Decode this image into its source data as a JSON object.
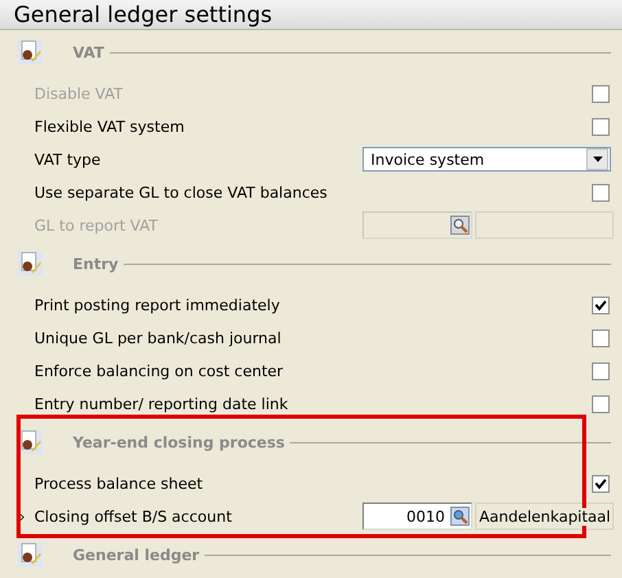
{
  "title": "General ledger settings",
  "sections": [
    {
      "heading": "VAT",
      "highlighted": false,
      "rows": [
        {
          "kind": "checkbox",
          "label": "Disable VAT",
          "disabled": true,
          "checked": false
        },
        {
          "kind": "checkbox",
          "label": "Flexible VAT system",
          "disabled": false,
          "checked": false
        },
        {
          "kind": "select",
          "label": "VAT type",
          "disabled": false,
          "value": "Invoice system"
        },
        {
          "kind": "checkbox",
          "label": "Use separate GL to close VAT balances",
          "disabled": false,
          "checked": false
        },
        {
          "kind": "lookup",
          "label": "GL to report VAT",
          "disabled": true
        }
      ]
    },
    {
      "heading": "Entry",
      "highlighted": false,
      "rows": [
        {
          "kind": "checkbox",
          "label": "Print posting report immediately",
          "disabled": false,
          "checked": true
        },
        {
          "kind": "checkbox",
          "label": "Unique GL per bank/cash journal",
          "disabled": false,
          "checked": false
        },
        {
          "kind": "checkbox",
          "label": "Enforce balancing on cost center",
          "disabled": false,
          "checked": false
        },
        {
          "kind": "checkbox",
          "label": "Entry number/ reporting date link",
          "disabled": false,
          "checked": false
        }
      ]
    },
    {
      "heading": "Year-end closing process",
      "highlighted": true,
      "rows": [
        {
          "kind": "checkbox",
          "label": "Process balance sheet",
          "disabled": false,
          "checked": true
        },
        {
          "kind": "lookup",
          "label": "Closing offset B/S account",
          "disabled": false,
          "value": "0010",
          "description": "Aandelenkapitaal",
          "marker": "›"
        }
      ]
    },
    {
      "heading": "General ledger",
      "highlighted": false
    }
  ]
}
